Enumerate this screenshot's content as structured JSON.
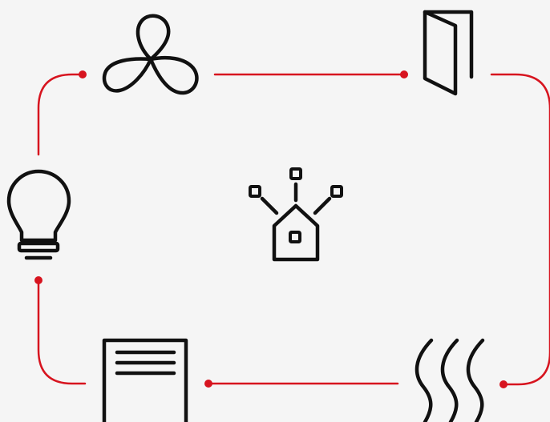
{
  "diagram": {
    "background": "#f5f5f5",
    "accent_color": "#d7141f",
    "icon_color": "#111111",
    "center_node": {
      "icon": "smart-home-hub-icon"
    },
    "ring_nodes": [
      {
        "id": "fan",
        "icon": "fan-icon"
      },
      {
        "id": "door",
        "icon": "door-icon"
      },
      {
        "id": "heat",
        "icon": "heat-waves-icon"
      },
      {
        "id": "blinds",
        "icon": "blinds-icon"
      },
      {
        "id": "light",
        "icon": "light-bulb-icon"
      }
    ],
    "connectors": [
      {
        "from": "fan",
        "to": "door",
        "arrowhead": "dot-at-door"
      },
      {
        "from": "door",
        "to": "heat",
        "arrowhead": "dot-at-heat"
      },
      {
        "from": "heat",
        "to": "blinds",
        "arrowhead": "dot-at-blinds"
      },
      {
        "from": "blinds",
        "to": "light",
        "arrowhead": "dot-at-light"
      },
      {
        "from": "light",
        "to": "fan",
        "arrowhead": "dot-at-fan"
      }
    ]
  }
}
